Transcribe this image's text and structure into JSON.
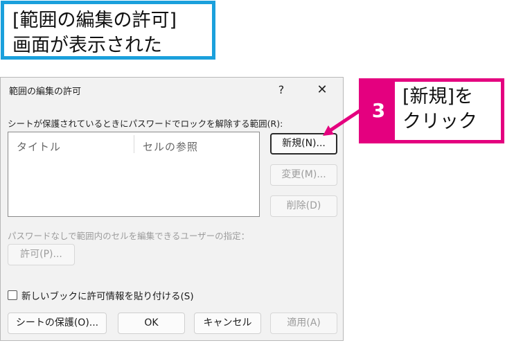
{
  "callout_top": {
    "line1": "[範囲の編集の許可]",
    "line2": "画面が表示された"
  },
  "dialog": {
    "title": "範囲の編集の許可",
    "help_label": "?",
    "close_label": "✕",
    "range_label": "シートが保護されているときにパスワードでロックを解除する範囲(R):",
    "columns": [
      "タイトル",
      "セルの参照"
    ],
    "new_label": "新規(N)...",
    "modify_label": "変更(M)...",
    "delete_label": "削除(D)",
    "user_label": "パスワードなしで範囲内のセルを編集できるユーザーの指定：",
    "permission_label": "許可(P)...",
    "checkbox_label": "新しいブックに許可情報を貼り付ける(S)",
    "protect_label": "シートの保護(O)...",
    "ok_label": "OK",
    "cancel_label": "キャンセル",
    "apply_label": "適用(A)"
  },
  "callout_right": {
    "step": "3",
    "line1": "[新規]を",
    "line2": "クリック"
  },
  "colors": {
    "top_border": "#1ba0dc",
    "step_accent": "#e4007f"
  }
}
